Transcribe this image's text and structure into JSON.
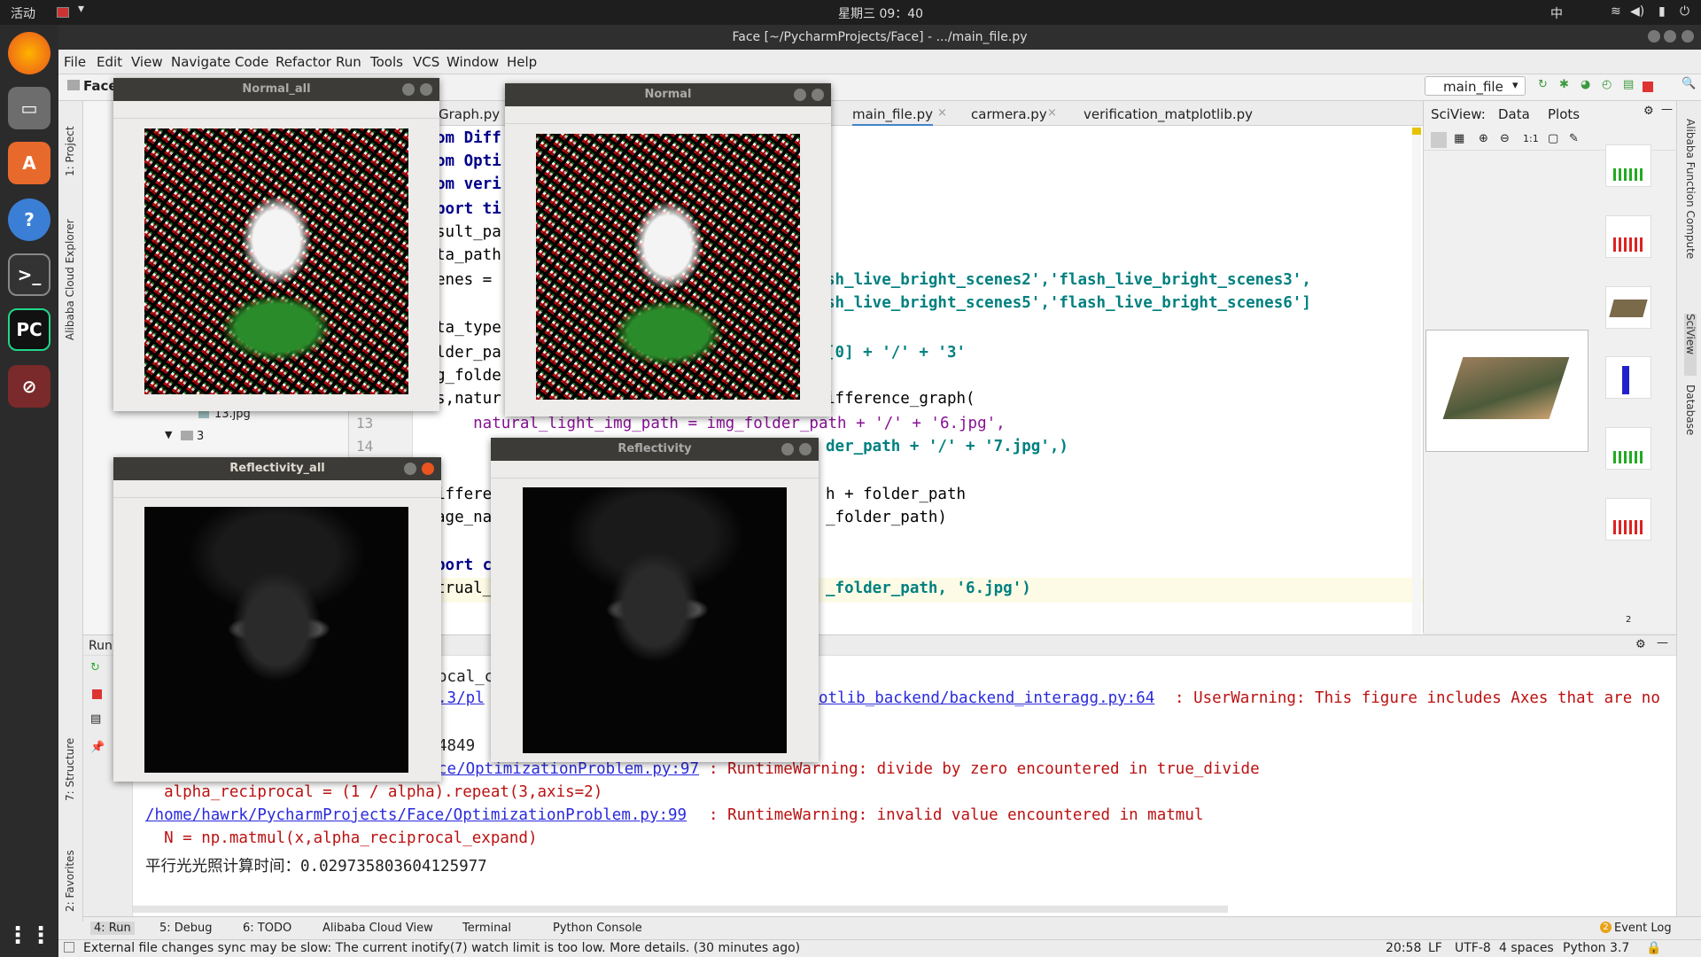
{
  "topbar": {
    "activities": "活动",
    "clock": "星期三 09：40",
    "input_method": "中"
  },
  "window_title": "Face [~/PycharmProjects/Face] - .../main_file.py",
  "menu": [
    "File",
    "Edit",
    "View",
    "Navigate",
    "Code",
    "Refactor",
    "Run",
    "Tools",
    "VCS",
    "Window",
    "Help"
  ],
  "nav": {
    "project": "Face",
    "run_config": "main_file"
  },
  "left_stripe": {
    "project": "1: Project",
    "cloud": "Alibaba Cloud Explorer",
    "structure": "7: Structure",
    "favorites": "2: Favorites"
  },
  "right_stripe": {
    "fc": "Alibaba Function Compute",
    "sciview": "SciView",
    "database": "Database"
  },
  "tree": {
    "file": "13.jpg",
    "folder": "3"
  },
  "tabs": [
    {
      "label": "Graph.py"
    },
    {
      "label": "main_file.py"
    },
    {
      "label": "carmera.py"
    },
    {
      "label": "verification_matplotlib.py"
    }
  ],
  "gutter_lines": [
    "13",
    "14"
  ],
  "code": {
    "l1": "om Diff",
    "l2": "om Opti",
    "l3": "om veri",
    "l4": "port ti",
    "l5": "sult_pa",
    "l6": "ta_path",
    "l7": "enes = ",
    "l7r": "sh_live_bright_scenes2','flash_live_bright_scenes3',",
    "l8r": "sh_live_bright_scenes5','flash_live_bright_scenes6']",
    "l9": "ta_type",
    "l10": "lder_pa",
    "l10r": "[0] + '/' + '3'",
    "l11": "g_folde",
    "l12": "s,natur",
    "l12r": "ifference_graph(",
    "l13": "    natural_light_img_path = img_folder_path + '/' + '6.jpg',",
    "l14r": "der_path + '/' + '7.jpg',)",
    "l15": "ifferen",
    "l15r": "h + folder_path",
    "l16": "age_na",
    "l16r": "_folder_path)",
    "l17": "port c",
    "l18": "trual_",
    "l18r": "_folder_path, '6.jpg')"
  },
  "sciview": {
    "title": "SciView:",
    "tab_data": "Data",
    "tab_plots": "Plots",
    "zoom": "1:1",
    "page": "2"
  },
  "run": {
    "title": "Run",
    "lines": {
      "c1": "ocal_c",
      "c2": ".3/pl",
      "c2r": "otlib_backend/backend_interagg.py:64",
      "c2w": ": UserWarning: This figure includes Axes that are no",
      "c3": "4849",
      "c4": "ce/OptimizationProblem.py:97",
      "c4w": ": RuntimeWarning: divide by zero encountered in true_divide",
      "c5": "  alpha_reciprocal = (1 / alpha).repeat(3,axis=2)",
      "c6": "/home/hawrk/PycharmProjects/Face/OptimizationProblem.py:99",
      "c6w": ": RuntimeWarning: invalid value encountered in matmul",
      "c7": "  N = np.matmul(x,alpha_reciprocal_expand)",
      "c8": "平行光光照计算时间：0.029735803604125977"
    }
  },
  "bottom_tools": [
    "4: Run",
    "5: Debug",
    "6: TODO",
    "Alibaba Cloud View",
    "Terminal",
    "Python Console"
  ],
  "event_log": {
    "count": "2",
    "label": "Event Log"
  },
  "status": {
    "message": "External file changes sync may be slow: The current inotify(7) watch limit is too low. More details. (30 minutes ago)",
    "position": "20:58",
    "line_sep": "LF",
    "encoding": "UTF-8",
    "indent": "4 spaces",
    "interpreter": "Python 3.7"
  },
  "windows": {
    "normal_all": "Normal_all",
    "normal": "Normal",
    "reflectivity_all": "Reflectivity_all",
    "reflectivity": "Reflectivity"
  }
}
